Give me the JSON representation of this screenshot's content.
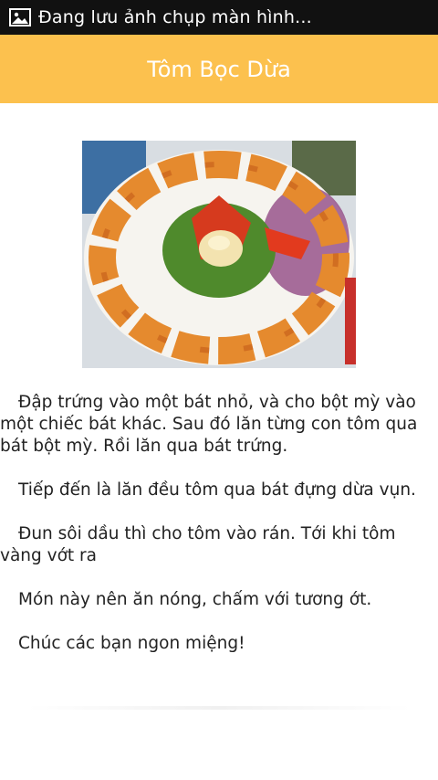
{
  "status_bar": {
    "text": "Đang lưu ảnh chụp màn hình...",
    "icon": "image-icon",
    "background": "#111111"
  },
  "action_bar": {
    "title": "Tôm Bọc Dừa",
    "background": "#fcc14e"
  },
  "content": {
    "image_alt": "dish-photo",
    "paragraphs": [
      "Đập trứng vào một bát nhỏ, và cho bột mỳ vào một chiếc bát khác. Sau đó lăn từng con tôm qua bát bột mỳ. Rồi lăn qua bát trứng.",
      "Tiếp đến là lăn đều tôm qua bát đựng dừa vụn.",
      "Đun sôi dầu thì cho tôm vào rán. Tới khi tôm vàng vớt ra",
      "Món này nên ăn nóng, chấm với tương ớt.",
      "Chúc các bạn ngon miệng!"
    ]
  }
}
